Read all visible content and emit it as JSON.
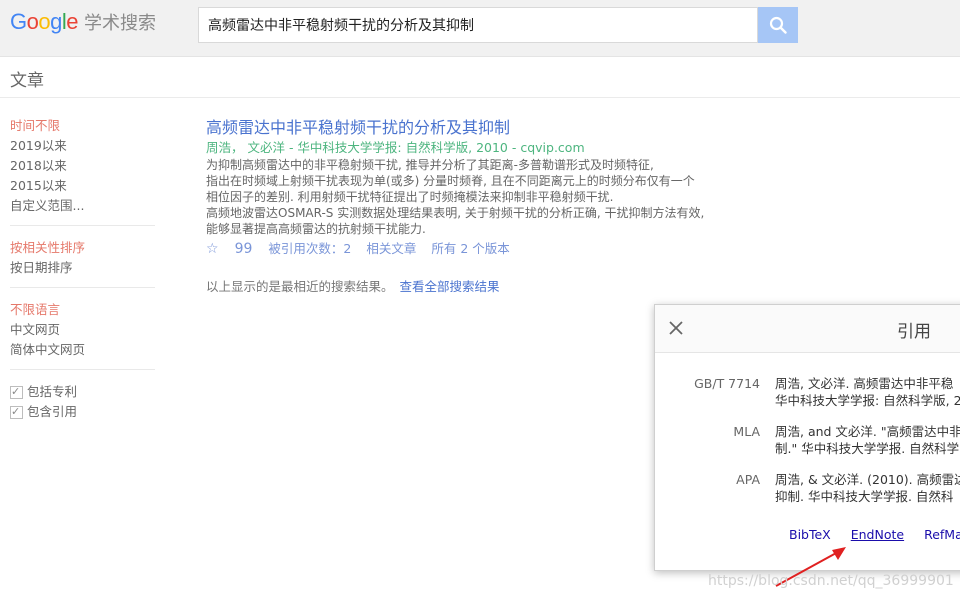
{
  "header": {
    "logo": {
      "letters": [
        "G",
        "o",
        "o",
        "g",
        "l",
        "e"
      ],
      "colors": [
        "#4285f4",
        "#ea4335",
        "#fbbc05",
        "#4285f4",
        "#34a853",
        "#ea4335"
      ],
      "product": "学术搜索"
    },
    "search": {
      "value": "高频雷达中非平稳射频干扰的分析及其抑制"
    },
    "search_button_icon": "search-icon"
  },
  "subheader": {
    "title": "文章"
  },
  "sidebar": {
    "time": [
      "时间不限",
      "2019以来",
      "2018以来",
      "2015以来",
      "自定义范围..."
    ],
    "sort": [
      "按相关性排序",
      "按日期排序"
    ],
    "lang": [
      "不限语言",
      "中文网页",
      "简体中文网页"
    ],
    "options": [
      "包括专利",
      "包含引用"
    ]
  },
  "result": {
    "title": "高频雷达中非平稳射频干扰的分析及其抑制",
    "meta": "周浩， 文必洋 - 华中科技大学学报: 自然科学版, 2010 - cqvip.com",
    "snippet": [
      "为抑制高频雷达中的非平稳射频干扰, 推导并分析了其距离-多普勒谱形式及时频特征,",
      "指出在时频域上射频干扰表现为单(或多) 分量时频脊, 且在不同距离元上的时频分布仅有一个",
      "相位因子的差别. 利用射频干扰特征提出了时频掩模法来抑制非平稳射频干扰.",
      "高频地波雷达OSMAR-S 实测数据处理结果表明, 关于射频干扰的分析正确, 干扰抑制方法有效,",
      "能够显著提高高频雷达的抗射频干扰能力."
    ],
    "actions": {
      "star": "☆",
      "quote": "99",
      "cited": "被引用次数：2",
      "related": "相关文章",
      "versions": "所有 2 个版本"
    }
  },
  "footer_note": {
    "text": "以上显示的是最相近的搜索结果。",
    "link": "查看全部搜索结果"
  },
  "cite_dialog": {
    "title": "引用",
    "close_icon": "close-icon",
    "rows": [
      {
        "label": "GB/T 7714",
        "lines": [
          "周浩, 文必洋. 高频雷达中非平稳",
          "华中科技大学学报: 自然科学版, 2"
        ]
      },
      {
        "label": "MLA",
        "lines": [
          "周浩, and 文必洋. \"高频雷达中非",
          "制.\" 华中科技大学学报. 自然科学"
        ]
      },
      {
        "label": "APA",
        "lines": [
          "周浩, & 文必洋. (2010). 高频雷达",
          "抑制. 华中科技大学学报. 自然科"
        ]
      }
    ],
    "exports": [
      "BibTeX",
      "EndNote",
      "RefMan"
    ]
  },
  "watermark": "https://blog.csdn.net/qq_36999901"
}
